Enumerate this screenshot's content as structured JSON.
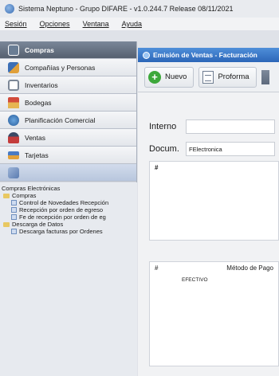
{
  "window": {
    "title": "Sistema Neptuno - Grupo DIFARE - v1.0.244.7 Release 08/11/2021"
  },
  "menu": [
    "Sesión",
    "Opciones",
    "Ventana",
    "Ayuda"
  ],
  "sidebar": {
    "items": [
      {
        "label": "Compras",
        "icon": "cart-icon"
      },
      {
        "label": "Compañías y Personas",
        "icon": "people-icon"
      },
      {
        "label": "Inventarios",
        "icon": "box-icon"
      },
      {
        "label": "Bodegas",
        "icon": "house-icon"
      },
      {
        "label": "Planificación Comercial",
        "icon": "globe-icon"
      },
      {
        "label": "Ventas",
        "icon": "person-icon"
      },
      {
        "label": "Tarjetas",
        "icon": "card-icon"
      }
    ]
  },
  "tree": {
    "root": "Compras Electrónicas",
    "groups": [
      {
        "label": "Compras",
        "items": [
          "Control de Novedades Recepción",
          "Recepción por orden de egreso",
          "Fe de recepción por orden de eg"
        ]
      },
      {
        "label": "Descarga de Datos",
        "items": [
          "Descarga facturas por Ordenes"
        ]
      }
    ]
  },
  "doc": {
    "title": "Emisión de Ventas - Facturación",
    "toolbar": {
      "new": "Nuevo",
      "proforma": "Proforma"
    },
    "fields": {
      "interno_label": "Interno",
      "docum_label": "Docum.",
      "docum_value": "FElectronica"
    },
    "grid1": {
      "header": "#"
    },
    "grid2": {
      "hash": "#",
      "col": "Método de Pago",
      "row1": "EFECTIVO"
    }
  }
}
